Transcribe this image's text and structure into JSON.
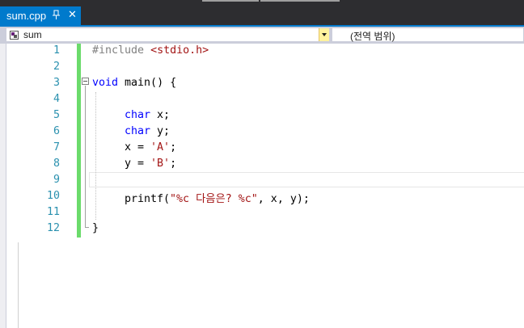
{
  "tab": {
    "title": "sum.cpp",
    "pin_icon": "pin-icon",
    "close_label": "✕"
  },
  "navbar": {
    "left_combo": "sum",
    "right_combo": "(전역 범위)"
  },
  "lines": [
    {
      "num": "1"
    },
    {
      "num": "2"
    },
    {
      "num": "3"
    },
    {
      "num": "4"
    },
    {
      "num": "5"
    },
    {
      "num": "6"
    },
    {
      "num": "7"
    },
    {
      "num": "8"
    },
    {
      "num": "9"
    },
    {
      "num": "10"
    },
    {
      "num": "11"
    },
    {
      "num": "12"
    }
  ],
  "code": {
    "l1_directive": "#include",
    "l1_header": "<stdio.h>",
    "l3_kw": "void",
    "l3_rest": " main() {",
    "l5_kw": "char",
    "l5_rest": " x;",
    "l6_kw": "char",
    "l6_rest": " y;",
    "l7_a": "x = ",
    "l7_str": "'A'",
    "l7_b": ";",
    "l8_a": "y = ",
    "l8_str": "'B'",
    "l8_b": ";",
    "l10_a": "printf(",
    "l10_str": "\"%c 다음은? %c\"",
    "l10_b": ", x, y);",
    "l12": "}"
  },
  "colors": {
    "keyword": "#0000ff",
    "string": "#a31515",
    "preprocessor": "#808080",
    "line_number": "#2b91af",
    "tab_active": "#007acc",
    "changed_bar": "#6bdb6b"
  }
}
